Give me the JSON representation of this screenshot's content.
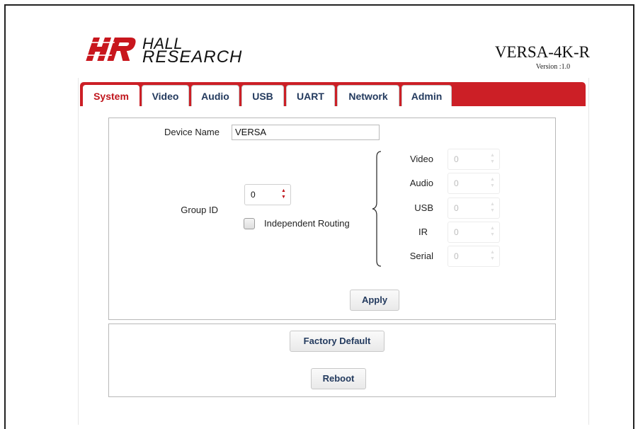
{
  "brand": {
    "logo_line1": "HALL",
    "logo_line2": "RESEARCH",
    "logo_mark": "HR"
  },
  "product": {
    "name": "VERSA-4K-R",
    "version": "Version :1.0"
  },
  "tabs": [
    {
      "label": "System",
      "active": true
    },
    {
      "label": "Video",
      "active": false
    },
    {
      "label": "Audio",
      "active": false
    },
    {
      "label": "USB",
      "active": false
    },
    {
      "label": "UART",
      "active": false
    },
    {
      "label": "Network",
      "active": false
    },
    {
      "label": "Admin",
      "active": false
    }
  ],
  "system": {
    "device_name_label": "Device Name",
    "device_name_value": "VERSA",
    "group_id_label": "Group ID",
    "group_id_value": "0",
    "independent_routing_label": "Independent Routing",
    "independent_routing_checked": false,
    "routing": [
      {
        "label": "Video",
        "value": "0"
      },
      {
        "label": "Audio",
        "value": "0"
      },
      {
        "label": "USB",
        "value": "0"
      },
      {
        "label": "IR",
        "value": "0"
      },
      {
        "label": "Serial",
        "value": "0"
      }
    ],
    "apply_label": "Apply",
    "factory_default_label": "Factory Default",
    "reboot_label": "Reboot"
  },
  "colors": {
    "accent": "#cc1f26",
    "tab_text": "#233a5e",
    "active_tab_text": "#c0151c"
  }
}
